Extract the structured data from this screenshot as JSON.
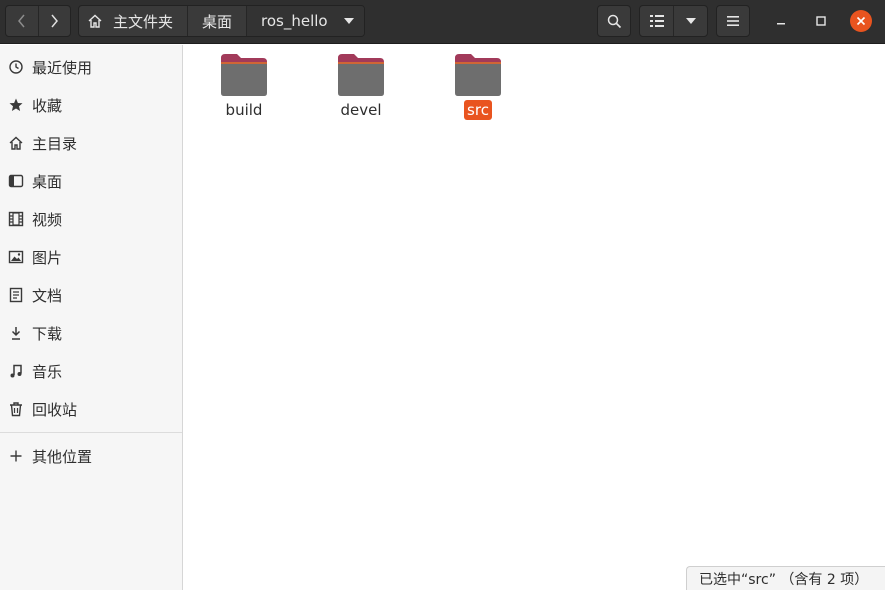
{
  "header": {
    "breadcrumbs": [
      "主文件夹",
      "桌面",
      "ros_hello"
    ]
  },
  "sidebar": {
    "items": [
      {
        "label": "最近使用",
        "icon": "recent-icon"
      },
      {
        "label": "收藏",
        "icon": "star-icon"
      },
      {
        "label": "主目录",
        "icon": "home-icon"
      },
      {
        "label": "桌面",
        "icon": "desktop-icon"
      },
      {
        "label": "视频",
        "icon": "video-icon"
      },
      {
        "label": "图片",
        "icon": "picture-icon"
      },
      {
        "label": "文档",
        "icon": "document-icon"
      },
      {
        "label": "下载",
        "icon": "download-icon"
      },
      {
        "label": "音乐",
        "icon": "music-icon"
      },
      {
        "label": "回收站",
        "icon": "trash-icon"
      },
      {
        "label": "其他位置",
        "icon": "plus-icon"
      }
    ]
  },
  "files": [
    {
      "name": "build",
      "selected": false
    },
    {
      "name": "devel",
      "selected": false
    },
    {
      "name": "src",
      "selected": true
    }
  ],
  "status": {
    "text": "已选中“src” （含有 2 项）"
  },
  "colors": {
    "accent": "#e9541f",
    "headerbar": "#2f2f2f",
    "folder_tab": "#a23a5a",
    "folder_body": "#6e6e6e"
  }
}
